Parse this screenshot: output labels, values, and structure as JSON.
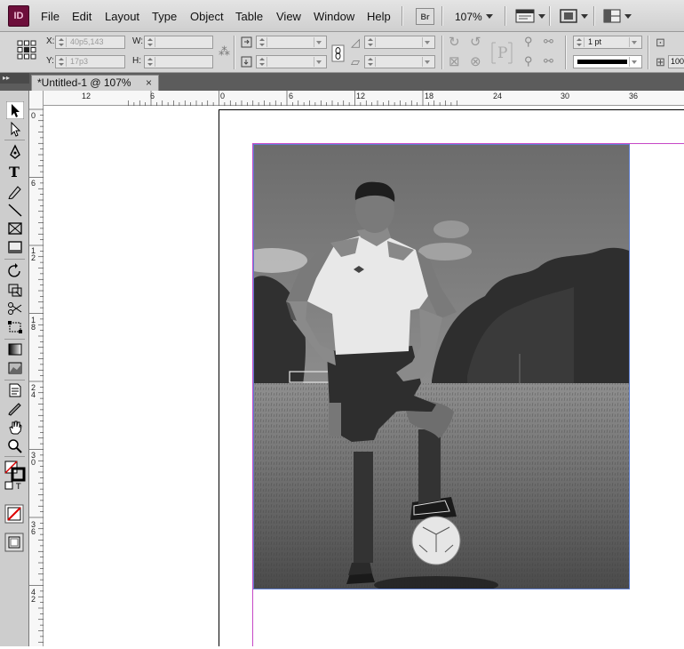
{
  "app": {
    "logo": "ID"
  },
  "menu": [
    "File",
    "Edit",
    "Layout",
    "Type",
    "Object",
    "Table",
    "View",
    "Window",
    "Help"
  ],
  "bridge_label": "Br",
  "zoom_level": "107%",
  "control": {
    "x_label": "X:",
    "x_value": "40p5,143",
    "y_label": "Y:",
    "y_value": "17p3",
    "w_label": "W:",
    "w_value": "",
    "h_label": "H:",
    "h_value": "",
    "stroke_weight": "1 pt",
    "ref_value": "100"
  },
  "document_tab": {
    "title": "*Untitled-1 @ 107%",
    "close": "×"
  },
  "ruler": {
    "horizontal": [
      "12",
      "6",
      "0",
      "6",
      "12",
      "18",
      "24",
      "30",
      "36"
    ],
    "vertical": [
      "0",
      "6",
      "1 2",
      "1 8",
      "2 4",
      "3 0",
      "3 6",
      "4 2"
    ]
  },
  "tools": [
    "selection-tool",
    "direct-selection-tool",
    "pen-tool",
    "type-tool",
    "pencil-tool",
    "line-tool",
    "rectangle-frame-tool",
    "rectangle-tool",
    "rotate-tool",
    "scale-tool",
    "scissors-tool",
    "free-transform-tool",
    "gradient-tool",
    "gradient-feather-tool",
    "note-tool",
    "eyedropper-tool",
    "hand-tool",
    "zoom-tool",
    "fill-stroke-swatch",
    "formatting-container",
    "apply-none",
    "screen-mode"
  ],
  "colors": {
    "margin_guide": "#c648c6",
    "frame_edge": "#5f7fd0",
    "toolbox_bg": "#cdcdcd"
  }
}
